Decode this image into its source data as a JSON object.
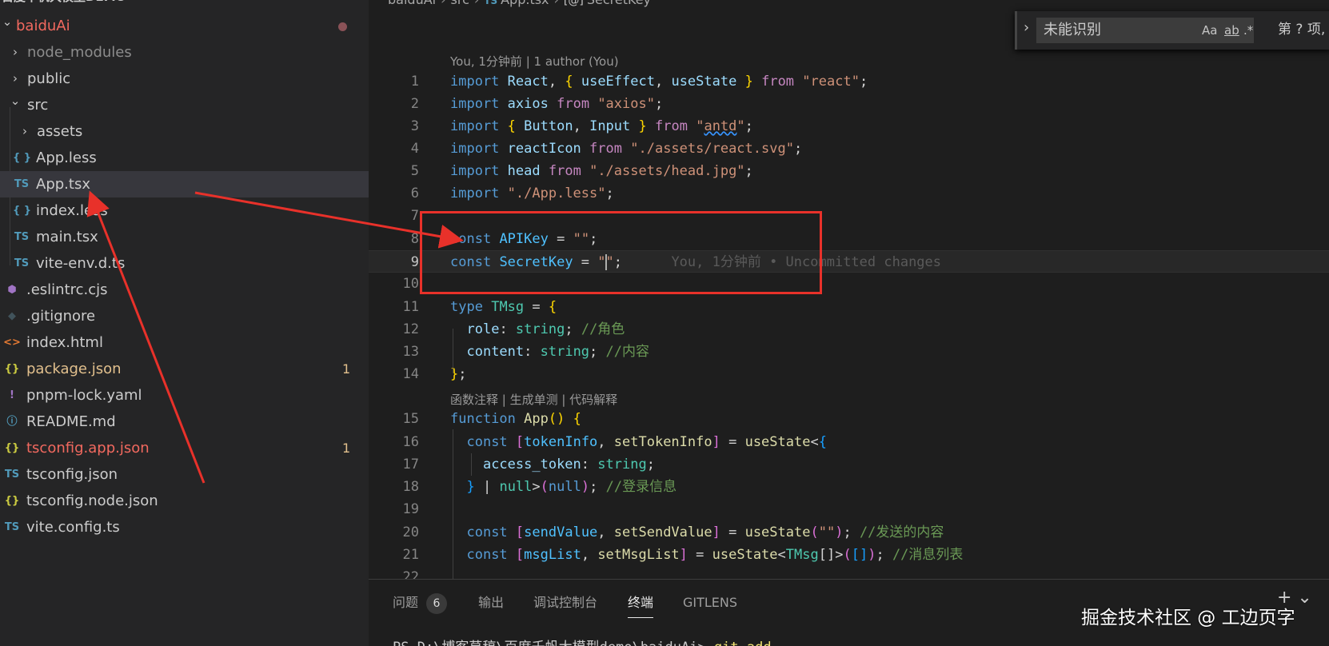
{
  "sidebar": {
    "header": "百度千帆大模型DEMO",
    "items": [
      {
        "name": "baiduAi",
        "kind": "folder-open",
        "icon": "chevron-down-icon",
        "color": "#f2695f",
        "dot": true
      },
      {
        "name": "node_modules",
        "kind": "folder-closed",
        "icon": "chevron-right-icon",
        "color": "#8c8c8c"
      },
      {
        "name": "public",
        "kind": "folder-closed",
        "icon": "chevron-right-icon",
        "color": "#cccccc"
      },
      {
        "name": "src",
        "kind": "folder-open",
        "icon": "chevron-down-icon",
        "color": "#cccccc"
      },
      {
        "name": "assets",
        "kind": "folder-closed",
        "icon": "chevron-right-icon",
        "color": "#cccccc"
      },
      {
        "name": "App.less",
        "kind": "file",
        "icon": "less-file-icon",
        "glyph": "{ }",
        "glyph_color": "#519aba",
        "color": "#cccccc"
      },
      {
        "name": "App.tsx",
        "kind": "file",
        "icon": "typescript-file-icon",
        "glyph": "TS",
        "glyph_color": "#519aba",
        "color": "#cccccc",
        "selected": true
      },
      {
        "name": "index.less",
        "kind": "file",
        "icon": "less-file-icon",
        "glyph": "{ }",
        "glyph_color": "#519aba",
        "color": "#cccccc"
      },
      {
        "name": "main.tsx",
        "kind": "file",
        "icon": "typescript-file-icon",
        "glyph": "TS",
        "glyph_color": "#519aba",
        "color": "#cccccc"
      },
      {
        "name": "vite-env.d.ts",
        "kind": "file",
        "icon": "typescript-file-icon",
        "glyph": "TS",
        "glyph_color": "#519aba",
        "color": "#cccccc"
      },
      {
        "name": ".eslintrc.cjs",
        "kind": "file",
        "icon": "eslint-file-icon",
        "glyph": "⬢",
        "glyph_color": "#a074c4",
        "color": "#cccccc"
      },
      {
        "name": ".gitignore",
        "kind": "file",
        "icon": "git-file-icon",
        "glyph": "◆",
        "glyph_color": "#41535b",
        "color": "#cccccc"
      },
      {
        "name": "index.html",
        "kind": "file",
        "icon": "html-file-icon",
        "glyph": "<>",
        "glyph_color": "#e37933",
        "color": "#cccccc"
      },
      {
        "name": "package.json",
        "kind": "file",
        "icon": "json-file-icon",
        "glyph": "{}",
        "glyph_color": "#cbcb41",
        "color": "#e2c08d",
        "badge": "1"
      },
      {
        "name": "pnpm-lock.yaml",
        "kind": "file",
        "icon": "yaml-file-icon",
        "glyph": "!",
        "glyph_color": "#a074c4",
        "color": "#cccccc"
      },
      {
        "name": "README.md",
        "kind": "file",
        "icon": "info-file-icon",
        "glyph": "ⓘ",
        "glyph_color": "#519aba",
        "color": "#cccccc"
      },
      {
        "name": "tsconfig.app.json",
        "kind": "file",
        "icon": "json-file-icon",
        "glyph": "{}",
        "glyph_color": "#cbcb41",
        "color": "#f2695f",
        "badge": "1"
      },
      {
        "name": "tsconfig.json",
        "kind": "file",
        "icon": "tsconfig-file-icon",
        "glyph": "TS",
        "glyph_color": "#519aba",
        "color": "#cccccc"
      },
      {
        "name": "tsconfig.node.json",
        "kind": "file",
        "icon": "json-file-icon",
        "glyph": "{}",
        "glyph_color": "#cbcb41",
        "color": "#cccccc"
      },
      {
        "name": "vite.config.ts",
        "kind": "file",
        "icon": "typescript-file-icon",
        "glyph": "TS",
        "glyph_color": "#519aba",
        "color": "#cccccc"
      }
    ]
  },
  "breadcrumb": {
    "root": "baiduAi",
    "folder": "src",
    "file": "App.tsx",
    "file_badge": "TS",
    "symbol": "SecretKey",
    "symbol_badge": "[@]"
  },
  "find": {
    "value": "未能识别",
    "match_case": "Aa",
    "whole_word": "ab",
    "regex": ".*",
    "count": "第 ? 项,"
  },
  "blame": {
    "header": "You, 1分钟前 | 1 author (You)",
    "codelens": "函数注释 | 生成单测 | 代码解释",
    "inline": "You, 1分钟前 • Uncommitted changes"
  },
  "code": {
    "line_numbers": [
      "1",
      "2",
      "3",
      "4",
      "5",
      "6",
      "7",
      "8",
      "9",
      "10",
      "11",
      "12",
      "13",
      "14",
      "15",
      "16",
      "17",
      "18",
      "19",
      "20",
      "21",
      "22"
    ],
    "lines": [
      [
        [
          "kw",
          "import"
        ],
        [
          "p",
          " "
        ],
        [
          "var",
          "React"
        ],
        [
          "p",
          ", "
        ],
        [
          "b1",
          "{"
        ],
        [
          "p",
          " "
        ],
        [
          "var",
          "useEffect"
        ],
        [
          "p",
          ", "
        ],
        [
          "var",
          "useState"
        ],
        [
          "p",
          " "
        ],
        [
          "b1",
          "}"
        ],
        [
          "p",
          " "
        ],
        [
          "ctrl",
          "from"
        ],
        [
          "p",
          " "
        ],
        [
          "str",
          "\"react\""
        ],
        [
          "p",
          ";"
        ]
      ],
      [
        [
          "kw",
          "import"
        ],
        [
          "p",
          " "
        ],
        [
          "var",
          "axios"
        ],
        [
          "p",
          " "
        ],
        [
          "ctrl",
          "from"
        ],
        [
          "p",
          " "
        ],
        [
          "str",
          "\"axios\""
        ],
        [
          "p",
          ";"
        ]
      ],
      [
        [
          "kw",
          "import"
        ],
        [
          "p",
          " "
        ],
        [
          "b1",
          "{"
        ],
        [
          "p",
          " "
        ],
        [
          "var",
          "Button"
        ],
        [
          "p",
          ", "
        ],
        [
          "var",
          "Input"
        ],
        [
          "p",
          " "
        ],
        [
          "b1",
          "}"
        ],
        [
          "p",
          " "
        ],
        [
          "ctrl",
          "from"
        ],
        [
          "p",
          " "
        ],
        [
          "str",
          "\""
        ],
        [
          "str squiggle",
          "antd"
        ],
        [
          "str",
          "\""
        ],
        [
          "p",
          ";"
        ]
      ],
      [
        [
          "kw",
          "import"
        ],
        [
          "p",
          " "
        ],
        [
          "var",
          "reactIcon"
        ],
        [
          "p",
          " "
        ],
        [
          "ctrl",
          "from"
        ],
        [
          "p",
          " "
        ],
        [
          "str",
          "\"./assets/react.svg\""
        ],
        [
          "p",
          ";"
        ]
      ],
      [
        [
          "kw",
          "import"
        ],
        [
          "p",
          " "
        ],
        [
          "var",
          "head"
        ],
        [
          "p",
          " "
        ],
        [
          "ctrl",
          "from"
        ],
        [
          "p",
          " "
        ],
        [
          "str",
          "\"./assets/head.jpg\""
        ],
        [
          "p",
          ";"
        ]
      ],
      [
        [
          "kw",
          "import"
        ],
        [
          "p",
          " "
        ],
        [
          "str",
          "\"./App.less\""
        ],
        [
          "p",
          ";"
        ]
      ],
      [],
      [
        [
          "kw",
          "const"
        ],
        [
          "p",
          " "
        ],
        [
          "cst",
          "APIKey"
        ],
        [
          "p",
          " = "
        ],
        [
          "str",
          "\"\""
        ],
        [
          "p",
          ";"
        ]
      ],
      [
        [
          "kw",
          "const"
        ],
        [
          "p",
          " "
        ],
        [
          "cst",
          "SecretKey"
        ],
        [
          "p",
          " = "
        ],
        [
          "str",
          "\""
        ],
        [
          "cursor",
          ""
        ],
        [
          "str",
          "\""
        ],
        [
          "p",
          ";"
        ],
        [
          "ghost",
          "      You, 1分钟前 • Uncommitted changes"
        ]
      ],
      [],
      [
        [
          "kw",
          "type"
        ],
        [
          "p",
          " "
        ],
        [
          "typ",
          "TMsg"
        ],
        [
          "p",
          " = "
        ],
        [
          "b1",
          "{"
        ]
      ],
      [
        [
          "p",
          "  "
        ],
        [
          "var",
          "role"
        ],
        [
          "p",
          ": "
        ],
        [
          "typ",
          "string"
        ],
        [
          "p",
          "; "
        ],
        [
          "cmt",
          "//角色"
        ]
      ],
      [
        [
          "p",
          "  "
        ],
        [
          "var",
          "content"
        ],
        [
          "p",
          ": "
        ],
        [
          "typ",
          "string"
        ],
        [
          "p",
          "; "
        ],
        [
          "cmt",
          "//内容"
        ]
      ],
      [
        [
          "b1",
          "}"
        ],
        [
          "p",
          ";"
        ]
      ],
      [
        [
          "kw",
          "function"
        ],
        [
          "p",
          " "
        ],
        [
          "fn",
          "App"
        ],
        [
          "b1",
          "("
        ],
        [
          "b1",
          ")"
        ],
        [
          "p",
          " "
        ],
        [
          "b1",
          "{"
        ]
      ],
      [
        [
          "p",
          "  "
        ],
        [
          "kw",
          "const"
        ],
        [
          "p",
          " "
        ],
        [
          "b2",
          "["
        ],
        [
          "cst",
          "tokenInfo"
        ],
        [
          "p",
          ", "
        ],
        [
          "fn",
          "setTokenInfo"
        ],
        [
          "b2",
          "]"
        ],
        [
          "p",
          " = "
        ],
        [
          "fn",
          "useState"
        ],
        [
          "p",
          "<"
        ],
        [
          "b3",
          "{"
        ]
      ],
      [
        [
          "p",
          "    "
        ],
        [
          "var",
          "access_token"
        ],
        [
          "p",
          ": "
        ],
        [
          "typ",
          "string"
        ],
        [
          "p",
          ";"
        ]
      ],
      [
        [
          "p",
          "  "
        ],
        [
          "b3",
          "}"
        ],
        [
          "p",
          " | "
        ],
        [
          "typ",
          "null"
        ],
        [
          "p",
          ">"
        ],
        [
          "b2",
          "("
        ],
        [
          "kw",
          "null"
        ],
        [
          "b2",
          ")"
        ],
        [
          "p",
          "; "
        ],
        [
          "cmt",
          "//登录信息"
        ]
      ],
      [],
      [
        [
          "p",
          "  "
        ],
        [
          "kw",
          "const"
        ],
        [
          "p",
          " "
        ],
        [
          "b2",
          "["
        ],
        [
          "cst",
          "sendValue"
        ],
        [
          "p",
          ", "
        ],
        [
          "fn",
          "setSendValue"
        ],
        [
          "b2",
          "]"
        ],
        [
          "p",
          " = "
        ],
        [
          "fn",
          "useState"
        ],
        [
          "b2",
          "("
        ],
        [
          "str",
          "\"\""
        ],
        [
          "b2",
          ")"
        ],
        [
          "p",
          "; "
        ],
        [
          "cmt",
          "//发送的内容"
        ]
      ],
      [
        [
          "p",
          "  "
        ],
        [
          "kw",
          "const"
        ],
        [
          "p",
          " "
        ],
        [
          "b2",
          "["
        ],
        [
          "cst",
          "msgList"
        ],
        [
          "p",
          ", "
        ],
        [
          "fn",
          "setMsgList"
        ],
        [
          "b2",
          "]"
        ],
        [
          "p",
          " = "
        ],
        [
          "fn",
          "useState"
        ],
        [
          "p",
          "<"
        ],
        [
          "typ",
          "TMsg"
        ],
        [
          "p",
          "[]>"
        ],
        [
          "b2",
          "("
        ],
        [
          "b3",
          "["
        ],
        [
          "b3",
          "]"
        ],
        [
          "b2",
          ")"
        ],
        [
          "p",
          "; "
        ],
        [
          "cmt",
          "//消息列表"
        ]
      ],
      []
    ],
    "current_line": "9"
  },
  "panel": {
    "tabs": [
      {
        "label": "问题",
        "count": "6"
      },
      {
        "label": "输出"
      },
      {
        "label": "调试控制台"
      },
      {
        "label": "终端",
        "active": true
      },
      {
        "label": "GITLENS"
      }
    ],
    "actions": "+ ⌄",
    "terminal_prompt": "PS D:\\博客草稿\\百度千帆大模型demo\\baiduAi> ",
    "terminal_cmd": "git add ."
  },
  "watermark": "掘金技术社区 @ 工边页字",
  "colors": {
    "annotation": "#e8312a",
    "accent": "#3794ff"
  }
}
